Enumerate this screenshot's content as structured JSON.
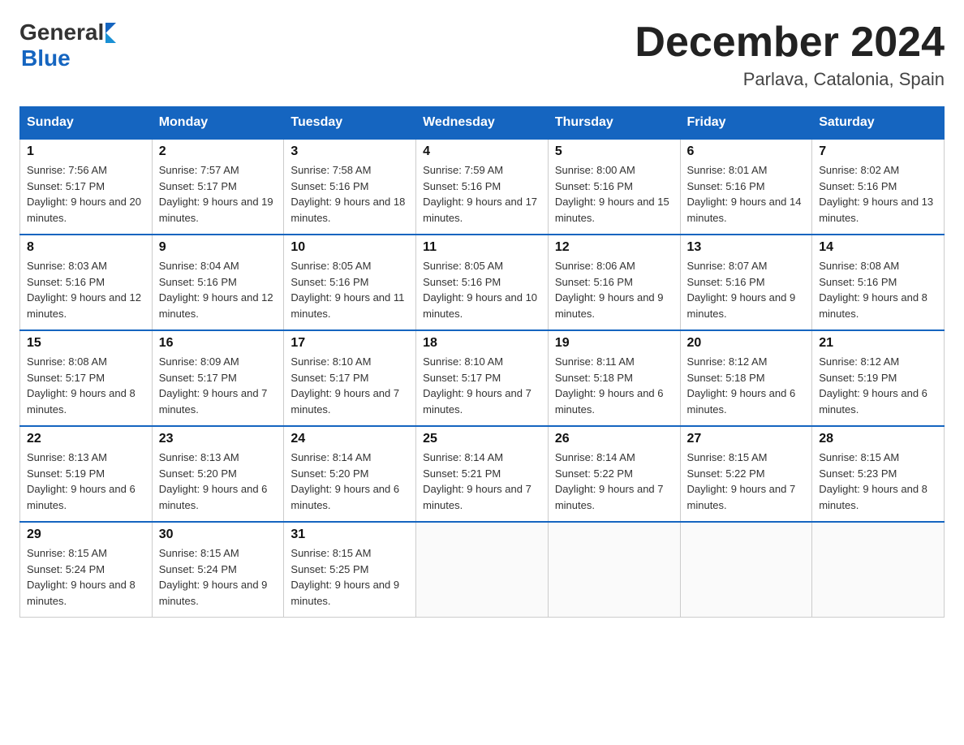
{
  "logo": {
    "text_general": "General",
    "arrow": "▶",
    "text_blue": "Blue"
  },
  "title": "December 2024",
  "location": "Parlava, Catalonia, Spain",
  "days_of_week": [
    "Sunday",
    "Monday",
    "Tuesday",
    "Wednesday",
    "Thursday",
    "Friday",
    "Saturday"
  ],
  "weeks": [
    [
      {
        "day": "1",
        "sunrise": "7:56 AM",
        "sunset": "5:17 PM",
        "daylight": "9 hours and 20 minutes."
      },
      {
        "day": "2",
        "sunrise": "7:57 AM",
        "sunset": "5:17 PM",
        "daylight": "9 hours and 19 minutes."
      },
      {
        "day": "3",
        "sunrise": "7:58 AM",
        "sunset": "5:16 PM",
        "daylight": "9 hours and 18 minutes."
      },
      {
        "day": "4",
        "sunrise": "7:59 AM",
        "sunset": "5:16 PM",
        "daylight": "9 hours and 17 minutes."
      },
      {
        "day": "5",
        "sunrise": "8:00 AM",
        "sunset": "5:16 PM",
        "daylight": "9 hours and 15 minutes."
      },
      {
        "day": "6",
        "sunrise": "8:01 AM",
        "sunset": "5:16 PM",
        "daylight": "9 hours and 14 minutes."
      },
      {
        "day": "7",
        "sunrise": "8:02 AM",
        "sunset": "5:16 PM",
        "daylight": "9 hours and 13 minutes."
      }
    ],
    [
      {
        "day": "8",
        "sunrise": "8:03 AM",
        "sunset": "5:16 PM",
        "daylight": "9 hours and 12 minutes."
      },
      {
        "day": "9",
        "sunrise": "8:04 AM",
        "sunset": "5:16 PM",
        "daylight": "9 hours and 12 minutes."
      },
      {
        "day": "10",
        "sunrise": "8:05 AM",
        "sunset": "5:16 PM",
        "daylight": "9 hours and 11 minutes."
      },
      {
        "day": "11",
        "sunrise": "8:05 AM",
        "sunset": "5:16 PM",
        "daylight": "9 hours and 10 minutes."
      },
      {
        "day": "12",
        "sunrise": "8:06 AM",
        "sunset": "5:16 PM",
        "daylight": "9 hours and 9 minutes."
      },
      {
        "day": "13",
        "sunrise": "8:07 AM",
        "sunset": "5:16 PM",
        "daylight": "9 hours and 9 minutes."
      },
      {
        "day": "14",
        "sunrise": "8:08 AM",
        "sunset": "5:16 PM",
        "daylight": "9 hours and 8 minutes."
      }
    ],
    [
      {
        "day": "15",
        "sunrise": "8:08 AM",
        "sunset": "5:17 PM",
        "daylight": "9 hours and 8 minutes."
      },
      {
        "day": "16",
        "sunrise": "8:09 AM",
        "sunset": "5:17 PM",
        "daylight": "9 hours and 7 minutes."
      },
      {
        "day": "17",
        "sunrise": "8:10 AM",
        "sunset": "5:17 PM",
        "daylight": "9 hours and 7 minutes."
      },
      {
        "day": "18",
        "sunrise": "8:10 AM",
        "sunset": "5:17 PM",
        "daylight": "9 hours and 7 minutes."
      },
      {
        "day": "19",
        "sunrise": "8:11 AM",
        "sunset": "5:18 PM",
        "daylight": "9 hours and 6 minutes."
      },
      {
        "day": "20",
        "sunrise": "8:12 AM",
        "sunset": "5:18 PM",
        "daylight": "9 hours and 6 minutes."
      },
      {
        "day": "21",
        "sunrise": "8:12 AM",
        "sunset": "5:19 PM",
        "daylight": "9 hours and 6 minutes."
      }
    ],
    [
      {
        "day": "22",
        "sunrise": "8:13 AM",
        "sunset": "5:19 PM",
        "daylight": "9 hours and 6 minutes."
      },
      {
        "day": "23",
        "sunrise": "8:13 AM",
        "sunset": "5:20 PM",
        "daylight": "9 hours and 6 minutes."
      },
      {
        "day": "24",
        "sunrise": "8:14 AM",
        "sunset": "5:20 PM",
        "daylight": "9 hours and 6 minutes."
      },
      {
        "day": "25",
        "sunrise": "8:14 AM",
        "sunset": "5:21 PM",
        "daylight": "9 hours and 7 minutes."
      },
      {
        "day": "26",
        "sunrise": "8:14 AM",
        "sunset": "5:22 PM",
        "daylight": "9 hours and 7 minutes."
      },
      {
        "day": "27",
        "sunrise": "8:15 AM",
        "sunset": "5:22 PM",
        "daylight": "9 hours and 7 minutes."
      },
      {
        "day": "28",
        "sunrise": "8:15 AM",
        "sunset": "5:23 PM",
        "daylight": "9 hours and 8 minutes."
      }
    ],
    [
      {
        "day": "29",
        "sunrise": "8:15 AM",
        "sunset": "5:24 PM",
        "daylight": "9 hours and 8 minutes."
      },
      {
        "day": "30",
        "sunrise": "8:15 AM",
        "sunset": "5:24 PM",
        "daylight": "9 hours and 9 minutes."
      },
      {
        "day": "31",
        "sunrise": "8:15 AM",
        "sunset": "5:25 PM",
        "daylight": "9 hours and 9 minutes."
      },
      null,
      null,
      null,
      null
    ]
  ]
}
